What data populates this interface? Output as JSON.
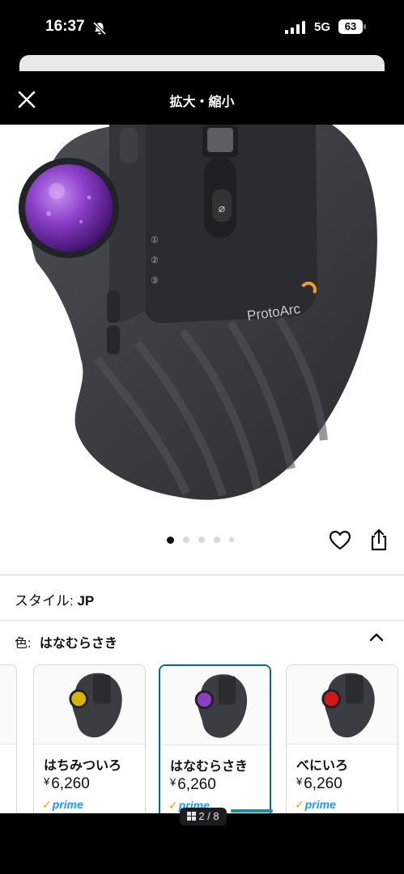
{
  "status_bar": {
    "time": "16:37",
    "network": "5G",
    "battery": "63"
  },
  "modal": {
    "title": "拡大・縮小"
  },
  "product": {
    "brand": "ProtoArc",
    "button_labels": [
      "①",
      "②",
      "③"
    ],
    "colors": {
      "accent": "#007185",
      "prime": "#1a98ff",
      "ball_purple": "#8b3fc9",
      "ball_yellow": "#d9b300",
      "ball_red": "#d01a1a"
    }
  },
  "carousel": {
    "dot_count": 5,
    "active_index": 0
  },
  "style": {
    "label": "スタイル:",
    "value": "JP"
  },
  "color": {
    "label": "色:",
    "value": "はなむらさき"
  },
  "variants": [
    {
      "name": "はちみついろ",
      "currency": "¥",
      "price": "6,260",
      "prime": "prime",
      "selected": false
    },
    {
      "name": "はなむらさき",
      "currency": "¥",
      "price": "6,260",
      "prime": "prime",
      "selected": true
    },
    {
      "name": "べにいろ",
      "currency": "¥",
      "price": "6,260",
      "prime": "prime",
      "selected": false
    }
  ],
  "pager": {
    "text": "2 / 8"
  },
  "icons": [
    "bell-slash-icon",
    "signal-icon",
    "battery-icon",
    "close-icon",
    "heart-icon",
    "share-icon",
    "chevron-up-icon",
    "grid-icon"
  ]
}
